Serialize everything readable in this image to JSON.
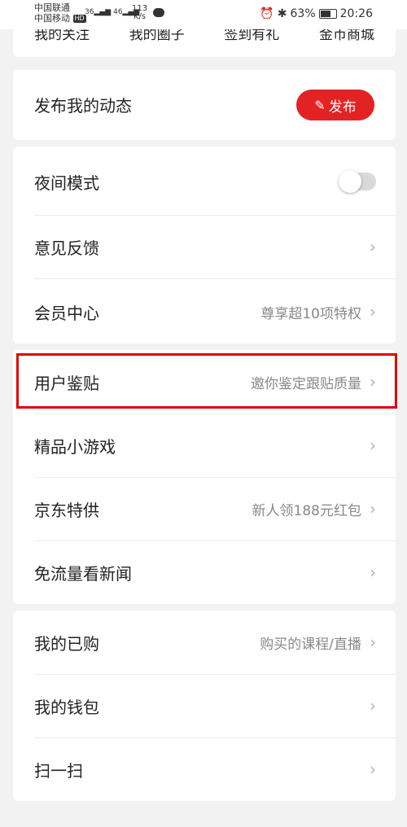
{
  "status_bar": {
    "carrier1": "中国联通",
    "carrier2": "中国移动",
    "hd": "HD",
    "signal1": "36",
    "signal2": "46",
    "net_speed_value": "113",
    "net_speed_unit": "K/s",
    "battery": "63%",
    "time": "20:26"
  },
  "top_links": [
    "我的关注",
    "我的圈子",
    "签到有礼",
    "金币商城"
  ],
  "post": {
    "title": "发布我的动态",
    "button_label": "发布"
  },
  "settings_group1": [
    {
      "label": "夜间模式",
      "type": "toggle",
      "value": "off"
    },
    {
      "label": "意见反馈",
      "hint": ""
    },
    {
      "label": "会员中心",
      "hint": "尊享超10项特权"
    }
  ],
  "settings_group2": [
    {
      "label": "用户鉴贴",
      "hint": "邀你鉴定跟贴质量"
    },
    {
      "label": "精品小游戏",
      "hint": ""
    },
    {
      "label": "京东特供",
      "hint": "新人领188元红包"
    },
    {
      "label": "免流量看新闻",
      "hint": ""
    }
  ],
  "settings_group3": [
    {
      "label": "我的已购",
      "hint": "购买的课程/直播"
    },
    {
      "label": "我的钱包",
      "hint": ""
    },
    {
      "label": "扫一扫",
      "hint": ""
    }
  ],
  "colors": {
    "accent_red": "#e32323",
    "highlight_border": "#e00000"
  }
}
